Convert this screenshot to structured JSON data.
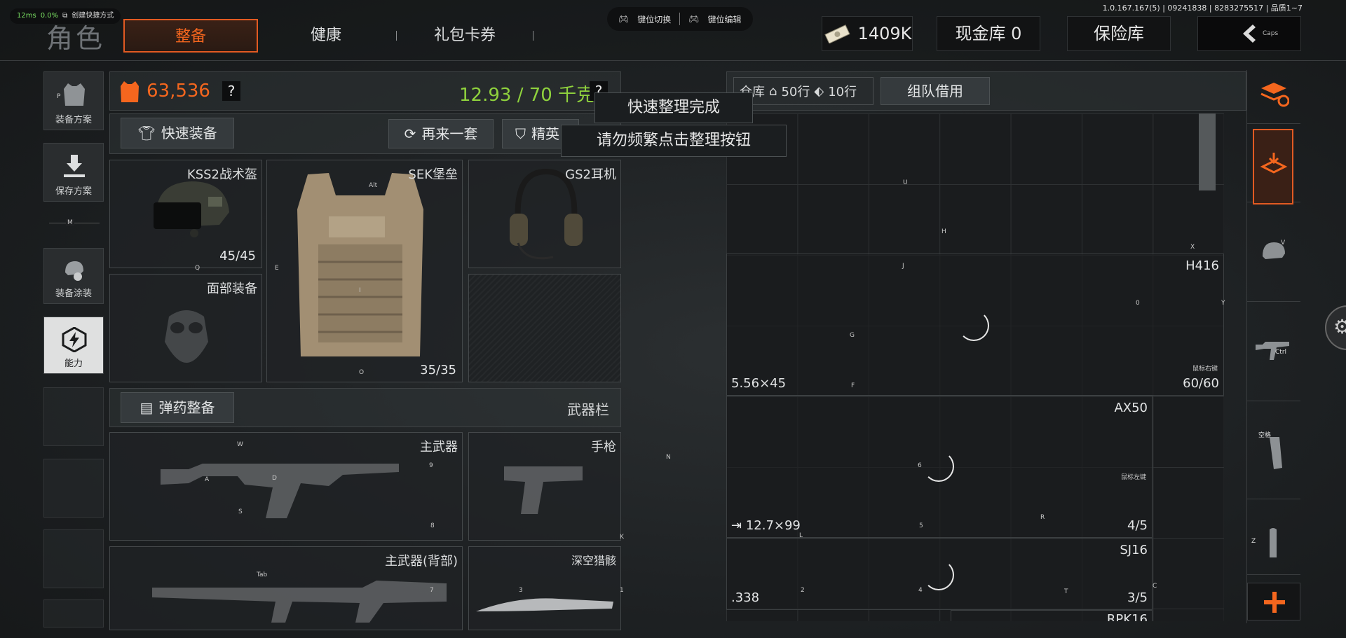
{
  "perf": {
    "ms": "12ms",
    "loss": "0.0%",
    "shortcut": "创建快捷方式"
  },
  "version": "1.0.167.167(5) | 09241838 | 8283275517 | 品质1~7",
  "header": {
    "role": "角色",
    "tabs": [
      "整备",
      "健康",
      "礼包卡券"
    ]
  },
  "keybar": {
    "switch": "键位切换",
    "edit": "键位编辑"
  },
  "top_buttons": {
    "money": "1409K",
    "cash_vault": "现金库 0",
    "safe_box": "保险库",
    "back_hint": "Caps"
  },
  "left_nav": [
    {
      "label": "装备方案",
      "hint": "P"
    },
    {
      "label": "保存方案",
      "hint": ""
    },
    {
      "label": "装备涂装",
      "hint": ""
    },
    {
      "label": "能力",
      "hint": ""
    }
  ],
  "left_nav_sep_hint": "M",
  "equip": {
    "value": "63,536",
    "weight": "12.93 / 70 千克",
    "help": "?",
    "quick_equip": "快速装备",
    "again": "再来一套",
    "elite": "精英",
    "slots": {
      "helmet": {
        "name": "KSS2战术盔",
        "count": "45/45"
      },
      "armor": {
        "name": "SEK堡垒",
        "count": "35/35"
      },
      "headset": {
        "name": "GS2耳机"
      },
      "face": {
        "name": "面部装备"
      }
    },
    "ammo_btn": "弹药整备",
    "weapon_bar": "武器栏",
    "weapons": {
      "primary": "主武器",
      "pistol": "手枪",
      "primary_back": "主武器(背部)",
      "melee": "深空猎骸"
    }
  },
  "toast": {
    "line1": "快速整理完成",
    "line2": "请勿频繁点击整理按钮"
  },
  "stash": {
    "title_prefix": "仓库",
    "rows": "50行",
    "rows2": "10行",
    "team_borrow": "组队借用",
    "items": [
      {
        "name": "H416",
        "ammo": "5.56×45",
        "count": "60/60",
        "tag": "鼠标右键"
      },
      {
        "name": "AX50",
        "ammo": "12.7×99",
        "count": "4/5",
        "tag": "鼠标左键"
      },
      {
        "name": "SJ16",
        "ammo": ".338",
        "count": "3/5",
        "tag": ""
      },
      {
        "name": "RPK16",
        "ammo": "",
        "count": "",
        "tag": ""
      }
    ]
  },
  "right_side": {
    "mag_label": "空格",
    "ctrl": "Ctrl",
    "key_v": "V",
    "key_z": "Z"
  },
  "key_hints": [
    "U",
    "H",
    "X",
    "J",
    "0",
    "Y",
    "G",
    "F",
    "6",
    "5",
    "R",
    "L",
    "2",
    "4",
    "T",
    "C",
    "N",
    "K",
    "W",
    "A",
    "D",
    "S",
    "9",
    "8",
    "Tab",
    "7",
    "3",
    "1",
    "E",
    "Q",
    "O",
    "Alt",
    "I"
  ],
  "colors": {
    "accent": "#f4661e",
    "weight_green": "#8fd23d"
  }
}
